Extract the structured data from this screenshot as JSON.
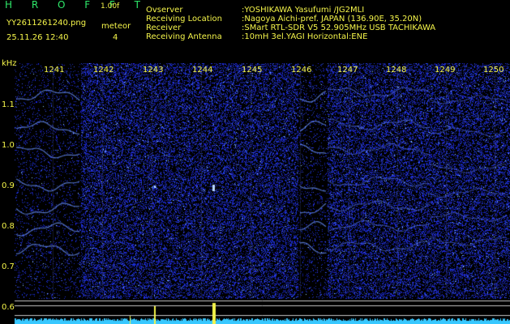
{
  "header": {
    "app_title": "H R O F F T",
    "version": "1.00f",
    "filename": "YY2611261240.png",
    "datetime": "25.11.26 12:40",
    "meteor_label": "meteor",
    "meteor_count": "4"
  },
  "station": {
    "observer_key": "Ovserver",
    "observer_val": ":YOSHIKAWA Yasufumi /JG2MLI",
    "location_key": "Receiving Location",
    "location_val": ":Nagoya Aichi-pref. JAPAN (136.90E, 35.20N)",
    "receiver_key": "Receiver",
    "receiver_val": ":SMart RTL-SDR V5 52.905MHz USB TACHIKAWA",
    "antenna_key": "Receiving Antenna",
    "antenna_val": ":10mH 3el.YAGI Horizontal:ENE"
  },
  "axis": {
    "y_unit": "kHz",
    "y_ticks": [
      "1.1",
      "1.0",
      "0.9",
      "0.8",
      "0.7",
      "0.6"
    ],
    "x_ticks": [
      "1241",
      "1242",
      "1243",
      "1244",
      "1245",
      "1246",
      "1247",
      "1248",
      "1249",
      "1250"
    ]
  },
  "colors": {
    "background": "#000000",
    "noise": "#1a2bd8",
    "highlight": "#8fd0ff",
    "text": "#f5f54a",
    "title": "#2ee86a",
    "bottom_trace": "#38c8ff"
  }
}
